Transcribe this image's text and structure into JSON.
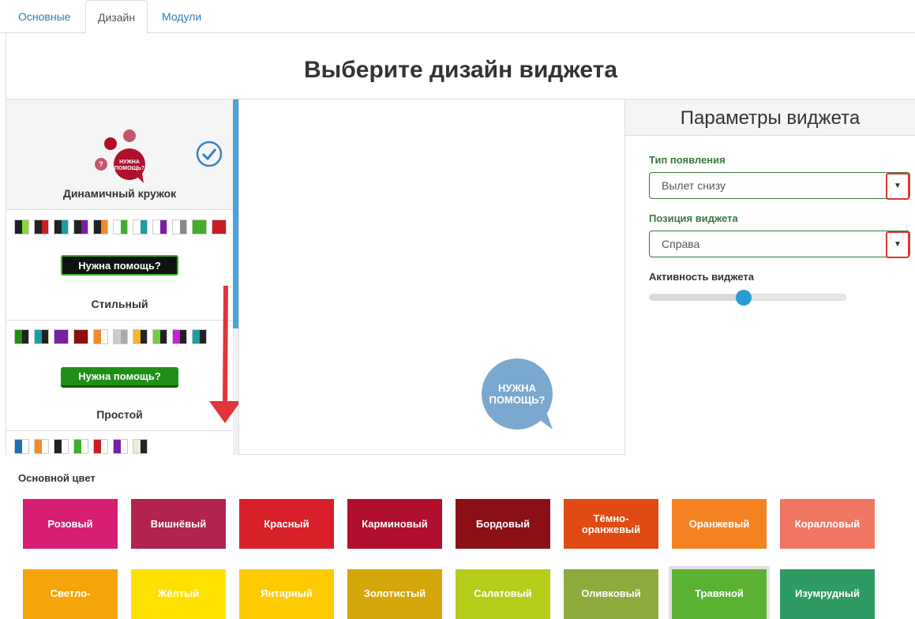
{
  "tabs": [
    {
      "label": "Основные",
      "active": false
    },
    {
      "label": "Дизайн",
      "active": true
    },
    {
      "label": "Модули",
      "active": false
    }
  ],
  "page_title": "Выберите дизайн виджета",
  "designs": [
    {
      "name": "Динамичный кружок",
      "selected": true,
      "badge_text": "НУЖНА ПОМОЩЬ?"
    },
    {
      "name": "Стильный",
      "button_text": "Нужна помощь?",
      "button_color": "#111111",
      "button_border": "#3fae29"
    },
    {
      "name": "Простой",
      "button_text": "Нужна помощь?",
      "button_color": "#1f8f17",
      "button_border": "#1a6e14"
    }
  ],
  "swatches": {
    "row1": [
      [
        "#222",
        "#8ad63a"
      ],
      [
        "#222",
        "#c81d25"
      ],
      [
        "#222",
        "#1a9ea5"
      ],
      [
        "#222",
        "#7a1fa2"
      ],
      [
        "#222",
        "#f28c28"
      ],
      [
        "#fff",
        "#3fae29"
      ],
      [
        "#fff",
        "#1a9ea5"
      ],
      [
        "#fff",
        "#7a1fa2"
      ],
      [
        "#fff",
        "#888"
      ],
      [
        "#3fae29",
        "#3fae29"
      ],
      [
        "#c81d25",
        "#c81d25"
      ]
    ],
    "row2": [
      [
        "#1f8f17",
        "#222"
      ],
      [
        "#1a9ea5",
        "#222"
      ],
      [
        "#7a1fa2",
        "#7a1fa2"
      ],
      [
        "#8b0f0f",
        "#8b0f0f"
      ],
      [
        "#f28c28",
        "#fff"
      ],
      [
        "#ccc",
        "#aaa"
      ],
      [
        "#f7b531",
        "#222"
      ],
      [
        "#7ac943",
        "#222"
      ],
      [
        "#c724d9",
        "#222"
      ],
      [
        "#1a9ea5",
        "#222"
      ]
    ],
    "row3": [
      [
        "#1a6fb5",
        "#fff"
      ],
      [
        "#f28c28",
        "#fff"
      ],
      [
        "#222",
        "#fff"
      ],
      [
        "#3fae29",
        "#fff"
      ],
      [
        "#c81d25",
        "#fff"
      ],
      [
        "#7a1fa2",
        "#fff"
      ],
      [
        "#e6f0d8",
        "#222"
      ]
    ]
  },
  "preview_badge": "НУЖНА ПОМОЩЬ?",
  "params": {
    "title": "Параметры виджета",
    "appearance_label": "Тип появления",
    "appearance_value": "Вылет снизу",
    "position_label": "Позиция виджета",
    "position_value": "Справа",
    "activity_label": "Активность виджета",
    "activity_level": 0.48,
    "caret": "▼"
  },
  "main_color": {
    "label": "Основной цвет",
    "tiles": [
      {
        "name": "Розовый",
        "color": "#d81e72"
      },
      {
        "name": "Вишнёвый",
        "color": "#b2234f"
      },
      {
        "name": "Красный",
        "color": "#d8202a"
      },
      {
        "name": "Карминовый",
        "color": "#b00f2e"
      },
      {
        "name": "Бордовый",
        "color": "#8b1015"
      },
      {
        "name": "Тёмно-оранжевый",
        "color": "#e04a13"
      },
      {
        "name": "Оранжевый",
        "color": "#f58220"
      },
      {
        "name": "Коралловый",
        "color": "#f07563"
      },
      {
        "name": "Светло-",
        "color": "#f5a50a"
      },
      {
        "name": "Жёлтый",
        "color": "#ffe100"
      },
      {
        "name": "Янтарный",
        "color": "#ffca00"
      },
      {
        "name": "Золотистый",
        "color": "#d4a70a"
      },
      {
        "name": "Салатовый",
        "color": "#b5cc18"
      },
      {
        "name": "Оливковый",
        "color": "#8daa3c"
      },
      {
        "name": "Травяной",
        "color": "#5bb131",
        "selected": true
      },
      {
        "name": "Изумрудный",
        "color": "#2f9b62"
      }
    ]
  }
}
